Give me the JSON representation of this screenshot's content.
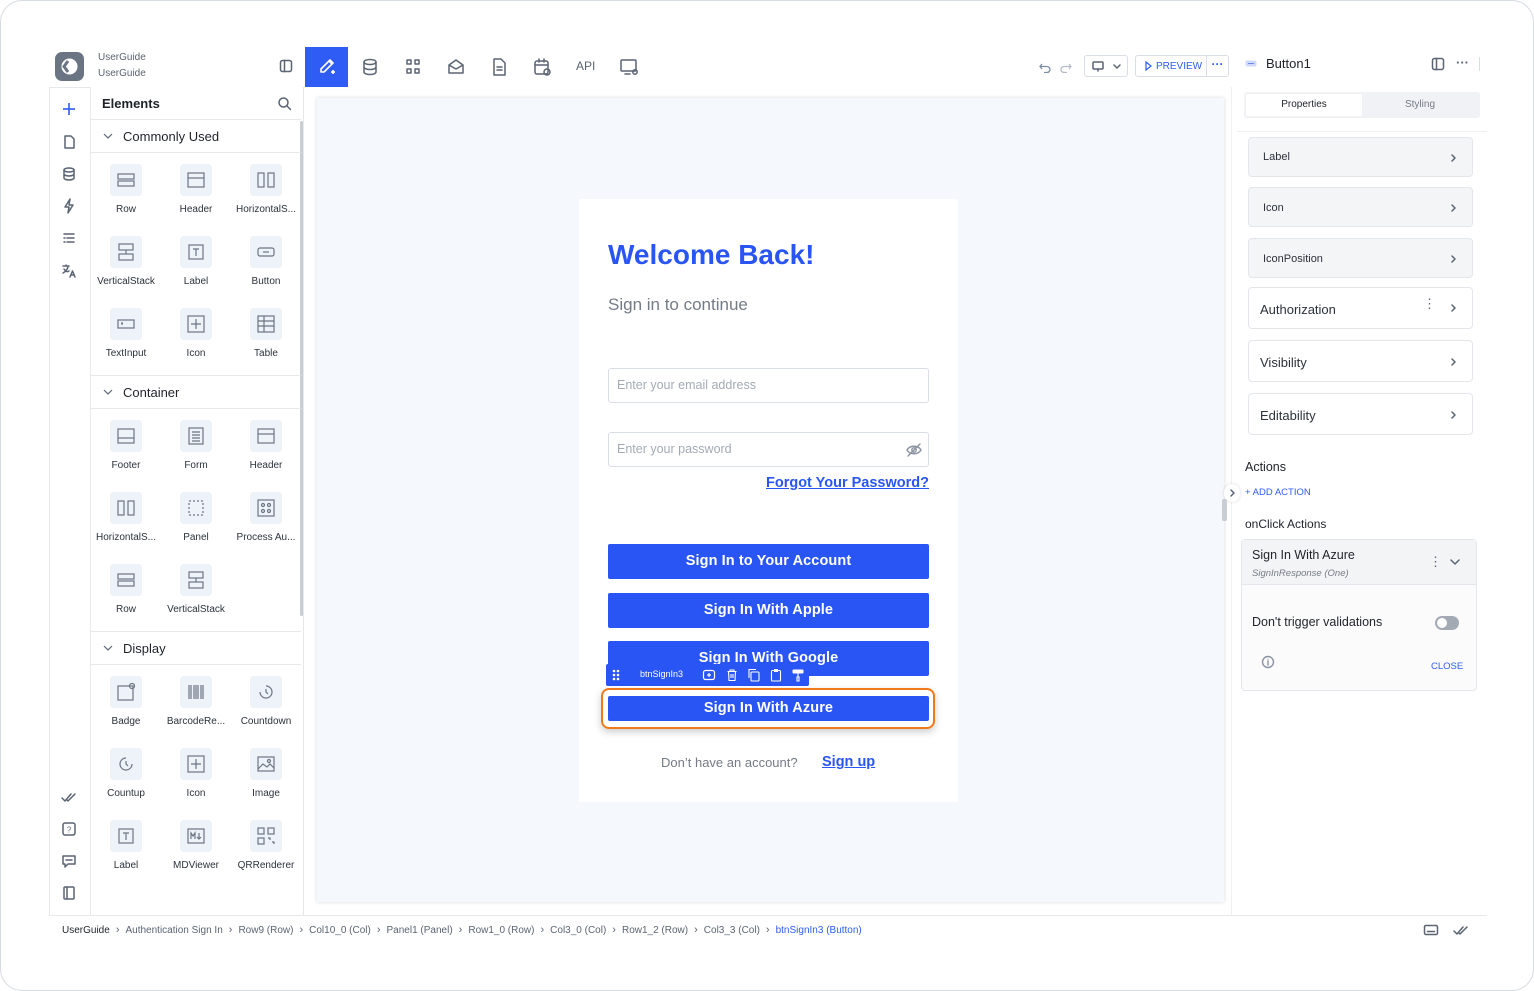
{
  "app": {
    "workspace": "UserGuide",
    "page": "UserGuide"
  },
  "toolbar": {
    "api_label": "API",
    "preview_label": "PREVIEW"
  },
  "elements_panel": {
    "title": "Elements",
    "sections": [
      {
        "title": "Commonly Used",
        "items": [
          "Row",
          "Header",
          "HorizontalS...",
          "VerticalStack",
          "Label",
          "Button",
          "TextInput",
          "Icon",
          "Table"
        ]
      },
      {
        "title": "Container",
        "items": [
          "Footer",
          "Form",
          "Header",
          "HorizontalS...",
          "Panel",
          "Process Au...",
          "Row",
          "VerticalStack"
        ]
      },
      {
        "title": "Display",
        "items": [
          "Badge",
          "BarcodeRe...",
          "Countdown",
          "Countup",
          "Icon",
          "Image",
          "Label",
          "MDViewer",
          "QRRenderer"
        ]
      }
    ]
  },
  "canvas": {
    "title": "Welcome Back!",
    "subtitle": "Sign in to continue",
    "email_placeholder": "Enter your email address",
    "password_placeholder": "Enter your password",
    "forgot_link": "Forgot Your Password?",
    "buttons": [
      "Sign In to Your Account",
      "Sign In With Apple",
      "Sign In With Google",
      "Sign In With Azure"
    ],
    "selected_widget_name": "btnSignIn3",
    "signup_prompt": "Don’t have an account?",
    "signup_link": "Sign up"
  },
  "inspector": {
    "component_name": "Button1",
    "tabs": [
      "Properties",
      "Styling"
    ],
    "active_tab": "Properties",
    "grey_props": [
      "Label",
      "Icon",
      "IconPosition"
    ],
    "white_props": [
      "Authorization",
      "Visibility",
      "Editability"
    ],
    "actions_title": "Actions",
    "add_action": "+ ADD ACTION",
    "onclick_title": "onClick Actions",
    "action_name": "Sign In With Azure",
    "action_sub": "SignInResponse (One)",
    "toggle_label": "Don't trigger validations",
    "toggle_on": false,
    "close_label": "CLOSE"
  },
  "breadcrumb": [
    "UserGuide",
    "Authentication Sign In",
    "Row9 (Row)",
    "Col10_0 (Col)",
    "Panel1 (Panel)",
    "Row1_0 (Row)",
    "Col3_0 (Col)",
    "Row1_2 (Row)",
    "Col3_3 (Col)",
    "btnSignIn3 (Button)"
  ],
  "colors": {
    "primary": "#2a55f5",
    "selection": "#f07a1a",
    "toolbar_active": "#2f5cf5"
  }
}
